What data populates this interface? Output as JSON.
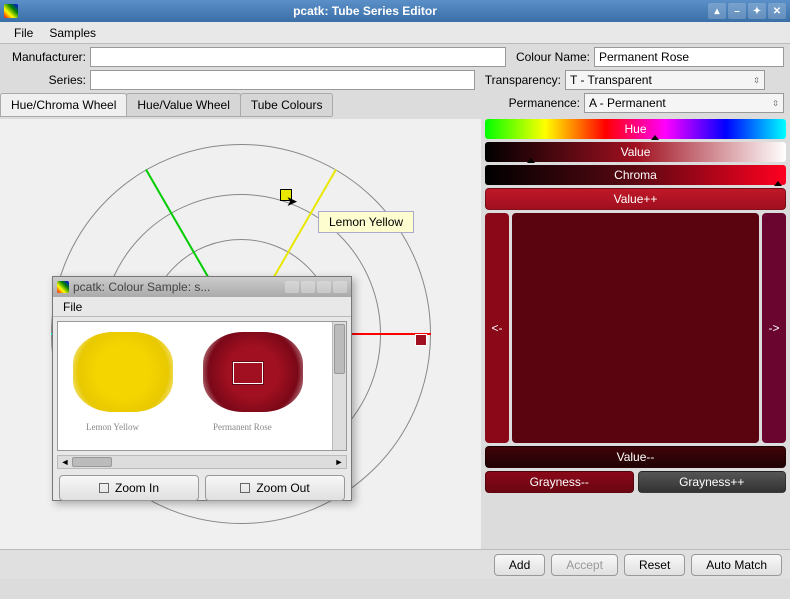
{
  "window": {
    "title": "pcatk: Tube Series Editor"
  },
  "menu": {
    "file": "File",
    "samples": "Samples"
  },
  "form": {
    "manufacturer_label": "Manufacturer:",
    "manufacturer_value": "",
    "series_label": "Series:",
    "series_value": "",
    "colour_name_label": "Colour Name:",
    "colour_name_value": "Permanent Rose",
    "transparency_label": "Transparency:",
    "transparency_value": "T     - Transparent",
    "permanence_label": "Permanence:",
    "permanence_value": "A     - Permanent"
  },
  "tabs": {
    "hue_chroma": "Hue/Chroma Wheel",
    "hue_value": "Hue/Value Wheel",
    "tube_colours": "Tube Colours"
  },
  "wheel": {
    "tooltip": "Lemon Yellow"
  },
  "sub_window": {
    "title": "pcatk: Colour Sample: s...",
    "menu_file": "File",
    "swatch1_label": "Lemon Yellow",
    "swatch2_label": "Permanent Rose",
    "zoom_in": "Zoom In",
    "zoom_out": "Zoom Out"
  },
  "sliders": {
    "hue": "Hue",
    "value": "Value",
    "chroma": "Chroma",
    "value_plus": "Value++",
    "value_minus": "Value--",
    "gray_minus": "Grayness--",
    "gray_plus": "Grayness++",
    "arrow_left": "<-",
    "arrow_right": "->"
  },
  "buttons": {
    "add": "Add",
    "accept": "Accept",
    "reset": "Reset",
    "auto_match": "Auto Match"
  }
}
